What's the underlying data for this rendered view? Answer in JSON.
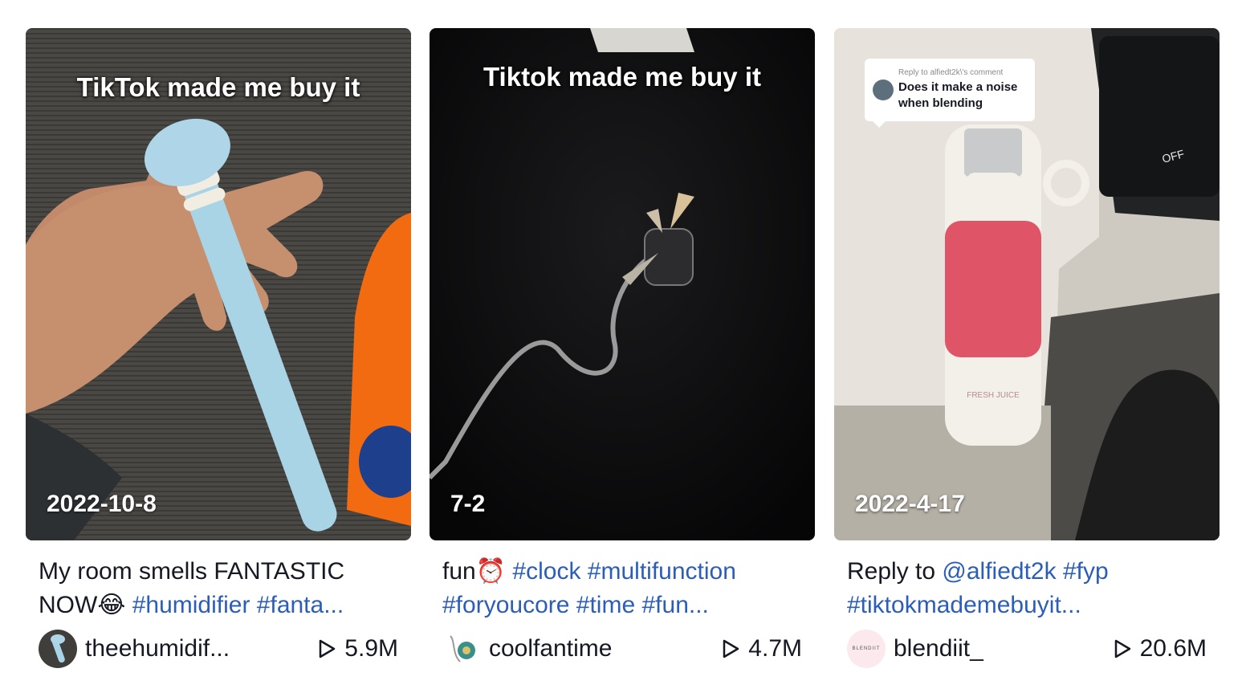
{
  "videos": [
    {
      "overlay": "TikTok made me buy it",
      "date": "2022-10-8",
      "caption_text": "My room smells FANTASTIC NOW😂 ",
      "hashtags": [
        "#humidifier",
        "#fanta..."
      ],
      "author": "theehumidif...",
      "views": "5.9M",
      "avatar_icon": "humidifier-avatar-icon"
    },
    {
      "overlay": "Tiktok made me buy it",
      "date": "7-2",
      "caption_text": "fun⏰ ",
      "hashtags": [
        "#clock",
        "#multifunction",
        "#foryoucore",
        "#time",
        "#fun..."
      ],
      "author": "coolfantime",
      "views": "4.7M",
      "avatar_icon": "fan-avatar-icon"
    },
    {
      "overlay": "",
      "date": "2022-4-17",
      "caption_text": "Reply to ",
      "hashtags": [
        "@alfiedt2k",
        "#fyp",
        "#tiktokmademebuyit..."
      ],
      "author": "blendiit_",
      "views": "20.6M",
      "avatar_icon": "blendiit-avatar-icon",
      "comment_bubble": {
        "reply_to": "Reply to alfiedt2k\\'s comment",
        "text": "Does it make a noise when blending"
      },
      "avatar_text": "BLENDIIT",
      "bottle_label": "FRESH JUICE",
      "car_display": "OFF"
    }
  ],
  "colors": {
    "hashtag": "#2b5db9",
    "text": "#161823"
  }
}
